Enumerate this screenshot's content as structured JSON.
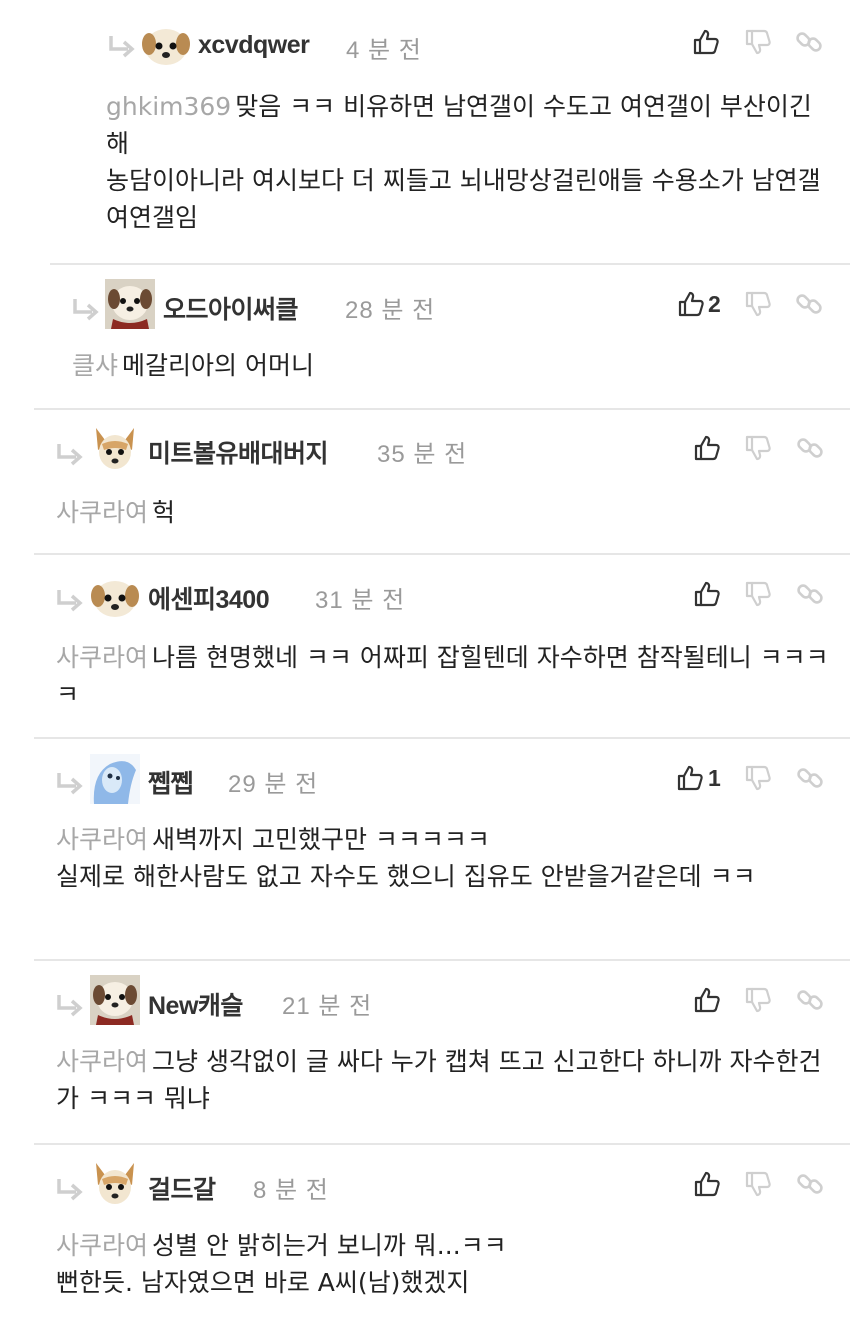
{
  "comments": [
    {
      "nick": "xcvdqwer",
      "time": "4 분 전",
      "mention": "ghkim369",
      "text": "맞음 ㅋㅋ 비유하면 남연갤이 수도고 여연갤이 부산이긴해\n농담이아니라 여시보다 더 찌들고 뇌내망상걸린애들 수용소가 남연갤 여연갤임",
      "likes": "",
      "avatar": "white-dog"
    },
    {
      "nick": "오드아이써클",
      "time": "28 분 전",
      "mention": "클샤",
      "text": "메갈리아의 어머니",
      "likes": "2",
      "avatar": "red-scarf-dog"
    },
    {
      "nick": "미트볼유배대버지",
      "time": "35 분 전",
      "mention": "사쿠라여",
      "text": "헉",
      "likes": "",
      "avatar": "tan-dog"
    },
    {
      "nick": "에센피3400",
      "time": "31 분 전",
      "mention": "사쿠라여",
      "text": "나름 현명했네 ㅋㅋ 어짜피 잡힐텐데 자수하면 참작될테니 ㅋㅋㅋㅋ",
      "likes": "",
      "avatar": "white-dog"
    },
    {
      "nick": "쩹쩹",
      "time": "29 분 전",
      "mention": "사쿠라여",
      "text": "새벽까지 고민했구만 ㅋㅋㅋㅋㅋ\n실제로 해한사람도 없고 자수도 했으니 집유도 안받을거같은데 ㅋㅋ",
      "likes": "1",
      "avatar": "blue-creature"
    },
    {
      "nick": "New캐슬",
      "time": "21 분 전",
      "mention": "사쿠라여",
      "text": "그냥 생각없이 글 싸다 누가 캡쳐 뜨고 신고한다 하니까 자수한건가 ㅋㅋㅋ 뭐냐",
      "likes": "",
      "avatar": "red-scarf-dog"
    },
    {
      "nick": "걸드갈",
      "time": "8 분 전",
      "mention": "사쿠라여",
      "text": "성별 안 밝히는거 보니까 뭐...ㅋㅋ\n뻔한듯. 남자였으면 바로 A씨(남)했겠지",
      "likes": "",
      "avatar": "tan-dog"
    }
  ],
  "icons": {
    "reply": "reply-arrow-icon",
    "like": "thumbs-up-icon",
    "dislike": "thumbs-down-icon",
    "link": "link-icon"
  },
  "colors": {
    "mention": "#a7a7a7",
    "time": "#9a9a9a",
    "divider": "#e6e6e6",
    "icon": "#333333"
  }
}
